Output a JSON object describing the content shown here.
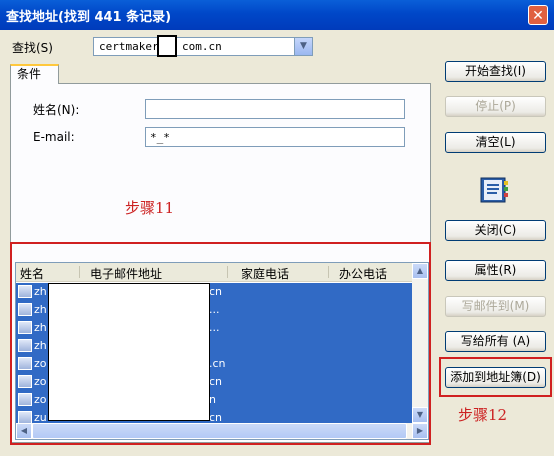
{
  "window": {
    "title": "查找地址(找到 441 条记录)",
    "close_glyph": "✕"
  },
  "search": {
    "label": "查找(S)",
    "value_pre": "certmaker.",
    "value_post": "com.cn"
  },
  "tab": {
    "label": "条件"
  },
  "fields": {
    "name_label": "姓名(N):",
    "name_value": "",
    "email_label": "E-mail:",
    "email_value": "*_*"
  },
  "annotations": {
    "step11": "步骤11",
    "step12": "步骤12"
  },
  "list": {
    "columns": [
      "姓名",
      "电子邮件地址",
      "家庭电话",
      "办公电话"
    ],
    "rows": [
      {
        "name": "zh",
        "email": "cn"
      },
      {
        "name": "zh",
        "email": "..."
      },
      {
        "name": "zh",
        "email": "..."
      },
      {
        "name": "zh",
        "email": ""
      },
      {
        "name": "zo",
        "email": ".cn"
      },
      {
        "name": "zo",
        "email": "cn"
      },
      {
        "name": "zo",
        "email": "n"
      },
      {
        "name": "zu",
        "email": "cn"
      }
    ]
  },
  "buttons": {
    "start": "开始查找(I)",
    "stop": "停止(P)",
    "clear": "清空(L)",
    "close": "关闭(C)",
    "properties": "属性(R)",
    "write_mail": "写邮件到(M)",
    "write_all": "写给所有 (A)",
    "add_to_book": "添加到地址簿(D)"
  }
}
